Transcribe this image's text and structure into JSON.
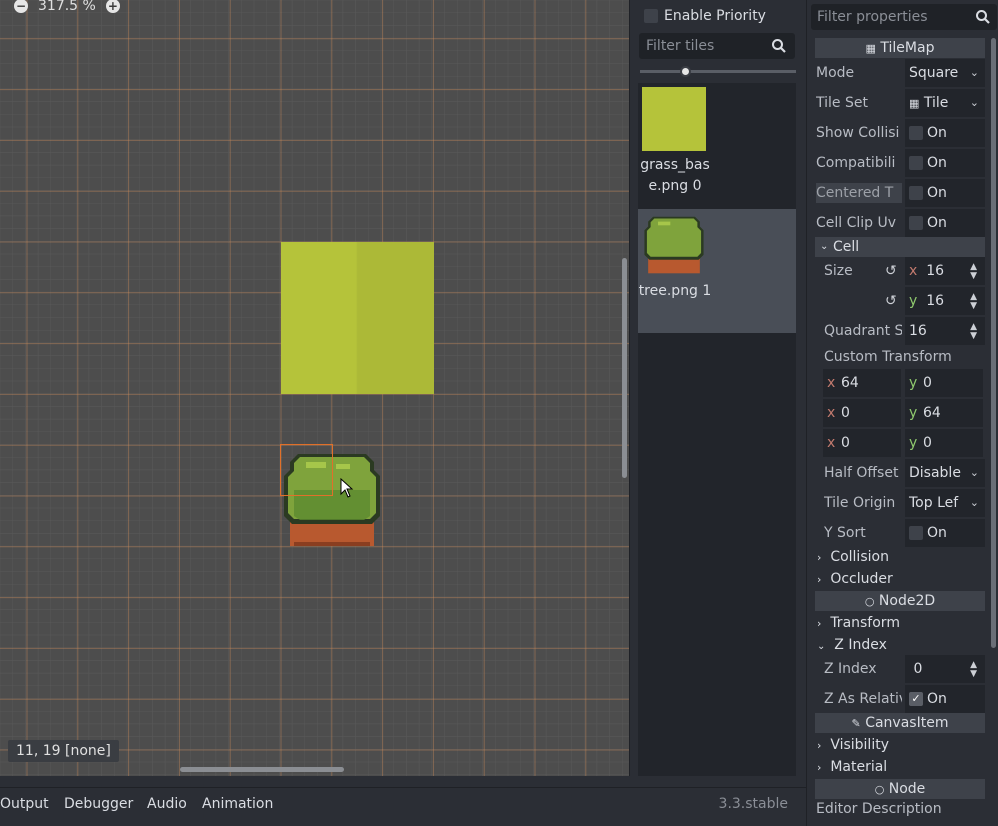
{
  "viewport": {
    "zoom_label": "317.5 %",
    "zoom_out_icon": "minus-circle-icon",
    "zoom_in_icon": "plus-circle-icon",
    "status_coords": "11, 19 [none]",
    "colors": {
      "background": "#4d4d4d",
      "grid": "#c88a5a",
      "grass_tile": "#b5c33a",
      "selection": "#e0702a"
    }
  },
  "palette": {
    "enable_priority_label": "Enable Priority",
    "filter_placeholder": "Filter tiles",
    "tiles": [
      {
        "label": "grass_base.png 0",
        "selected": false
      },
      {
        "label": "tree.png 1",
        "selected": true
      }
    ]
  },
  "inspector": {
    "filter_placeholder": "Filter properties",
    "tilemap_header": "TileMap",
    "mode_label": "Mode",
    "mode_value": "Square",
    "tileset_label": "Tile Set",
    "tileset_value": "Tile",
    "show_collision_label": "Show Collisi",
    "show_collision_value": "On",
    "compat_label": "Compatibili",
    "compat_value": "On",
    "centered_label": "Centered T",
    "centered_value": "On",
    "cell_clip_label": "Cell Clip Uv",
    "cell_clip_value": "On",
    "cell_section": "Cell",
    "size_label": "Size",
    "size_x": "16",
    "size_y": "16",
    "quadrant_label": "Quadrant S",
    "quadrant_value": "16",
    "custom_transform_label": "Custom Transform",
    "transform": {
      "r1x": "64",
      "r1y": "0",
      "r2x": "0",
      "r2y": "64",
      "r3x": "0",
      "r3y": "0"
    },
    "axis_x": "x",
    "axis_y": "y",
    "half_offset_label": "Half Offset",
    "half_offset_value": "Disable",
    "tile_origin_label": "Tile Origin",
    "tile_origin_value": "Top Lef",
    "ysort_label": "Y Sort",
    "ysort_value": "On",
    "collision_section": "Collision",
    "occluder_section": "Occluder",
    "node2d_header": "Node2D",
    "transform_section": "Transform",
    "zindex_section": "Z Index",
    "zindex_label": "Z Index",
    "zindex_value": "0",
    "zrel_label": "Z As Relativ",
    "zrel_value": "On",
    "canvasitem_header": "CanvasItem",
    "visibility_section": "Visibility",
    "material_section": "Material",
    "node_header": "Node",
    "editor_desc_label": "Editor Description"
  },
  "bottom": {
    "tabs": [
      "Output",
      "Debugger",
      "Audio",
      "Animation"
    ],
    "version": "3.3.stable"
  }
}
